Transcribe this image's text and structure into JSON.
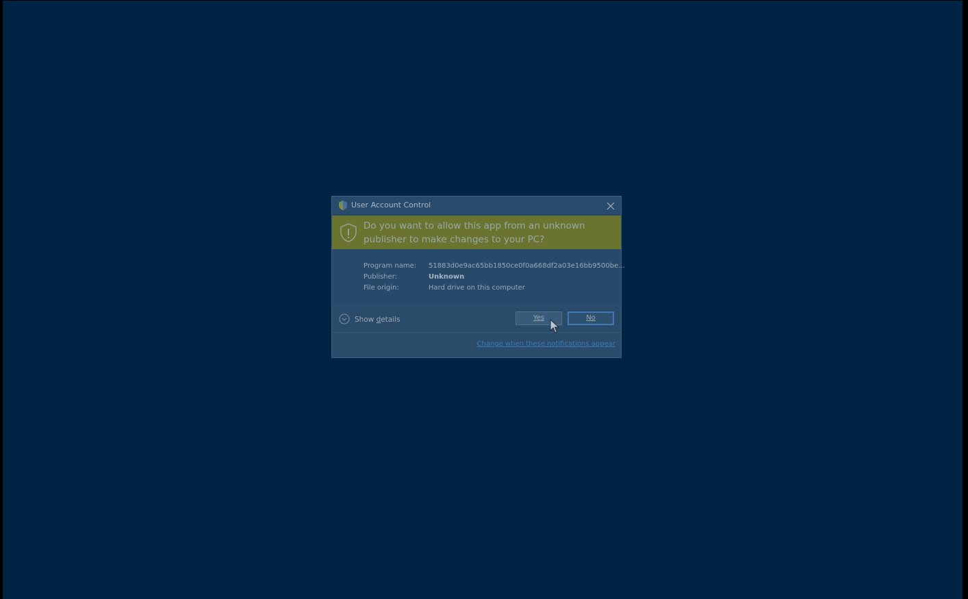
{
  "dialog": {
    "title": "User Account Control",
    "question": "Do you want to allow this app from an unknown publisher to make changes to your PC?",
    "info": [
      {
        "key": "Program name:",
        "value": "51883d0e9ac65bb1850ce0f0a668df2a03e16bb9500be..."
      },
      {
        "key": "Publisher:",
        "value": "Unknown"
      },
      {
        "key": "File origin:",
        "value": "Hard drive on this computer"
      }
    ],
    "show_details_prefix": "Show ",
    "show_details_accel": "d",
    "show_details_suffix": "etails",
    "yes_label": "Yes",
    "no_label": "No",
    "notification_link": "Change when these notifications appear"
  },
  "colors": {
    "desktop_background": "#002443",
    "dialog_background": "#284a6a",
    "banner_warning": "#6b742f",
    "link_accent": "#3f7ab8"
  },
  "icons": {
    "title": "uac-shield-icon",
    "banner": "warning-shield-icon",
    "close": "close-icon",
    "details": "chevron-down-circle-icon",
    "pointer": "mouse-pointer-icon"
  }
}
